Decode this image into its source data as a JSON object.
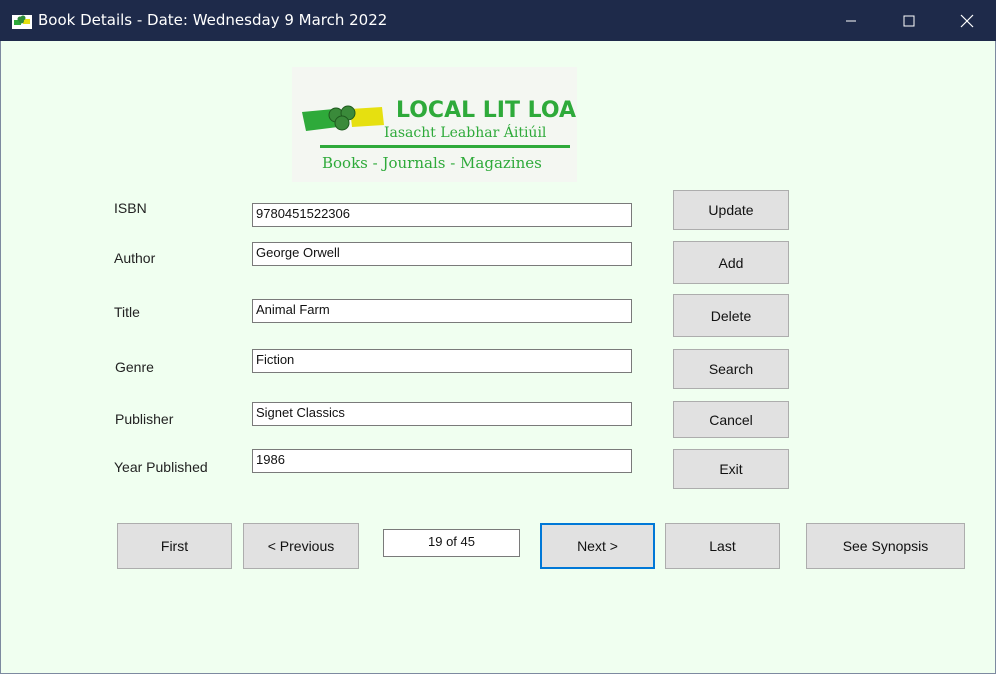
{
  "window": {
    "title": "Book Details  - Date: Wednesday 9 March 2022",
    "icon": "books-app-icon",
    "controls": [
      "minimize-icon",
      "maximize-icon",
      "close-icon"
    ]
  },
  "logo": {
    "name": "LOCAL LIT LOAN",
    "irish_name": "Iasacht Leabhar Áitiúil",
    "tagline": "Books - Journals - Magazines",
    "colors": {
      "green": "#2eaa3a",
      "yellow": "#e6e010"
    }
  },
  "form": {
    "isbn": {
      "label": "ISBN",
      "value": "9780451522306"
    },
    "author": {
      "label": "Author",
      "value": "George Orwell"
    },
    "title": {
      "label": "Title",
      "value": "Animal Farm"
    },
    "genre": {
      "label": "Genre",
      "value": "Fiction"
    },
    "publisher": {
      "label": "Publisher",
      "value": "Signet Classics"
    },
    "year": {
      "label": "Year Published",
      "value": "1986"
    }
  },
  "actions": {
    "update": "Update",
    "add": "Add",
    "delete": "Delete",
    "search": "Search",
    "cancel": "Cancel",
    "exit": "Exit"
  },
  "navigation": {
    "first": "First",
    "previous": "< Previous",
    "record_counter": "19 of 45",
    "next": "Next >",
    "last": "Last",
    "synopsis": "See Synopsis"
  },
  "colors": {
    "titlebar": "#1e2a4a",
    "background": "#f0fff0",
    "focus": "#0078d7"
  }
}
